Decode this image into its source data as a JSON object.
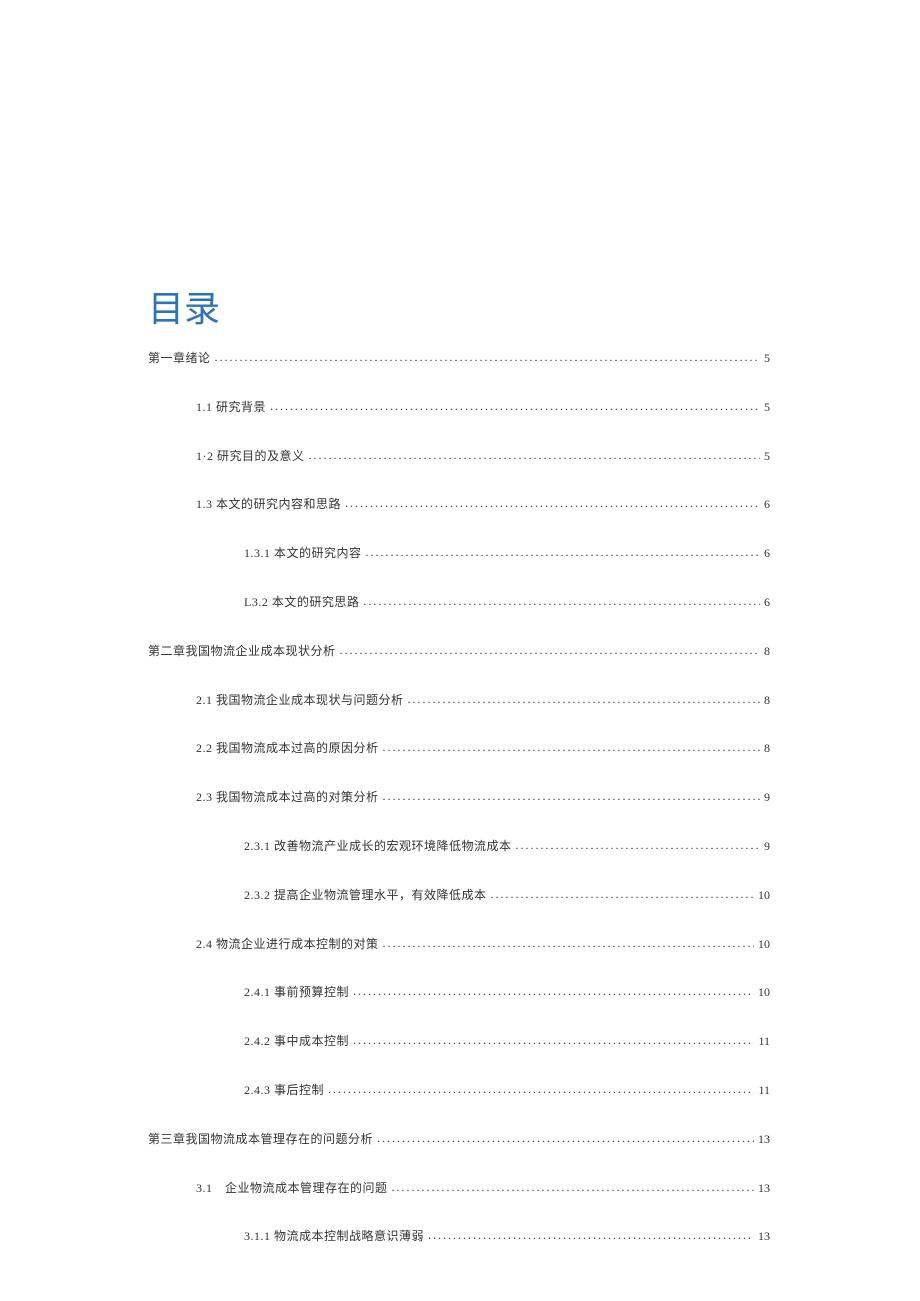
{
  "title": "目录",
  "entries": [
    {
      "level": 1,
      "label": "第一章绪论",
      "page": "5"
    },
    {
      "level": 2,
      "label": "1.1 研究背景",
      "page": "5"
    },
    {
      "level": 2,
      "label": "1·2 研究目的及意义",
      "page": "5"
    },
    {
      "level": 2,
      "label": "1.3 本文的研究内容和思路",
      "page": "6"
    },
    {
      "level": 3,
      "label": "1.3.1 本文的研究内容",
      "page": "6"
    },
    {
      "level": 3,
      "label": "L3.2 本文的研究思路",
      "page": "6"
    },
    {
      "level": 1,
      "label": "第二章我国物流企业成本现状分析",
      "page": "8"
    },
    {
      "level": 2,
      "label": "2.1 我国物流企业成本现状与问题分析",
      "page": "8"
    },
    {
      "level": 2,
      "label": "2.2 我国物流成本过高的原因分析",
      "page": "8"
    },
    {
      "level": 2,
      "label": "2.3 我国物流成本过高的对策分析",
      "page": "9"
    },
    {
      "level": 3,
      "label": "2.3.1 改善物流产业成长的宏观环境降低物流成本",
      "page": "9"
    },
    {
      "level": 3,
      "label": "2.3.2 提高企业物流管理水平，有效降低成本",
      "page": "10"
    },
    {
      "level": 2,
      "label": "2.4 物流企业进行成本控制的对策",
      "page": "10"
    },
    {
      "level": 3,
      "label": "2.4.1 事前预算控制",
      "page": "10"
    },
    {
      "level": 3,
      "label": "2.4.2 事中成本控制",
      "page": "11"
    },
    {
      "level": 3,
      "label": "2.4.3 事后控制",
      "page": "11"
    },
    {
      "level": 1,
      "label": "第三章我国物流成本管理存在的问题分析",
      "page": "13"
    },
    {
      "level": 2,
      "label": "3.1　企业物流成本管理存在的问题",
      "page": "13"
    },
    {
      "level": 3,
      "label": "3.1.1 物流成本控制战略意识薄弱",
      "page": "13"
    }
  ]
}
